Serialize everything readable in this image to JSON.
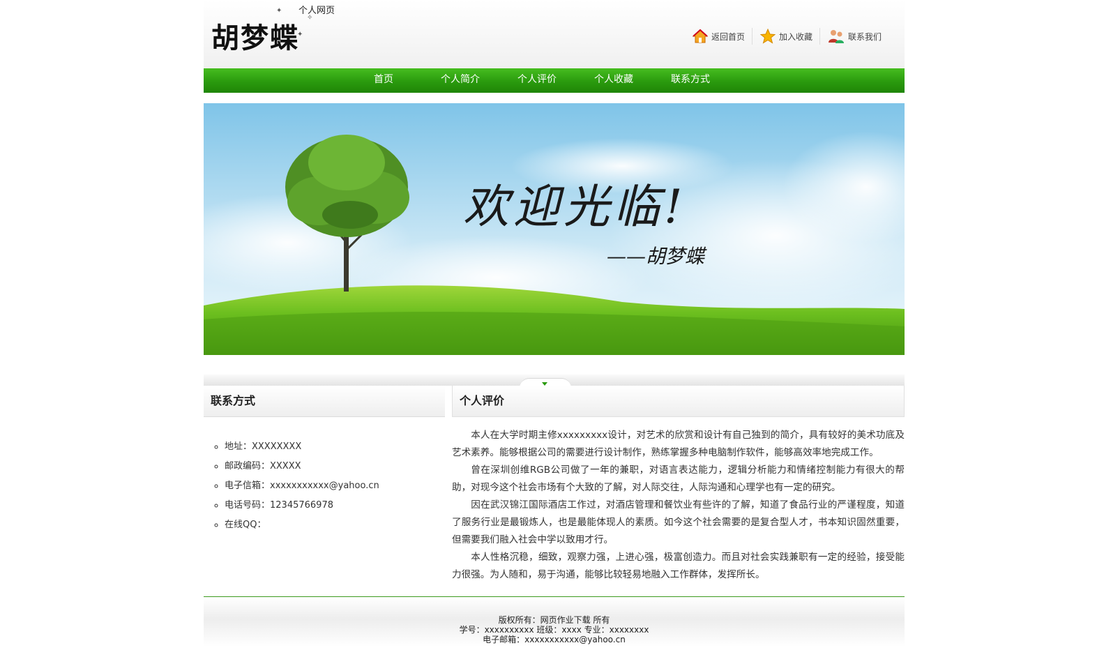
{
  "header": {
    "site_name": "胡梦蝶",
    "site_subtitle": "个人网页",
    "top_links": [
      {
        "label": "返回首页",
        "icon": "home-icon"
      },
      {
        "label": "加入收藏",
        "icon": "star-icon"
      },
      {
        "label": "联系我们",
        "icon": "users-icon"
      }
    ]
  },
  "nav": {
    "items": [
      "首页",
      "个人简介",
      "个人评价",
      "个人收藏",
      "联系方式"
    ]
  },
  "banner": {
    "welcome_text": "欢迎光临!",
    "signature": "——胡梦蝶"
  },
  "contact": {
    "title": "联系方式",
    "items": [
      "地址：XXXXXXXX",
      "邮政编码：XXXXX",
      "电子信箱：xxxxxxxxxxx@yahoo.cn",
      "电话号码：12345766978",
      "在线QQ："
    ]
  },
  "review": {
    "title": "个人评价",
    "paragraphs": [
      "本人在大学时期主修xxxxxxxxx设计，对艺术的欣赏和设计有自己独到的简介，具有较好的美术功底及艺术素养。能够根据公司的需要进行设计制作，熟练掌握多种电脑制作软件，能够高效率地完成工作。",
      "曾在深圳创维RGB公司做了一年的兼职，对语言表达能力，逻辑分析能力和情绪控制能力有很大的帮助，对现今这个社会市场有个大致的了解，对人际交往，人际沟通和心理学也有一定的研究。",
      "因在武汉锦江国际酒店工作过，对酒店管理和餐饮业有些许的了解，知道了食品行业的严谨程度，知道了服务行业是最锻炼人，也是最能体现人的素质。如今这个社会需要的是复合型人才，书本知识固然重要，但需要我们融入社会中学以致用才行。",
      "本人性格沉稳，细致，观察力强，上进心强，极富创造力。而且对社会实践兼职有一定的经验，接受能力很强。为人随和，易于沟通，能够比较轻易地融入工作群体，发挥所长。"
    ]
  },
  "footer": {
    "copyright_prefix": "版权所有：",
    "copyright_link": "网页作业下载",
    "copyright_suffix": " 所有",
    "line2": "学号：xxxxxxxxxx 班级：xxxx 专业：xxxxxxxx",
    "line3": "电子邮箱：xxxxxxxxxxx@yahoo.cn"
  }
}
